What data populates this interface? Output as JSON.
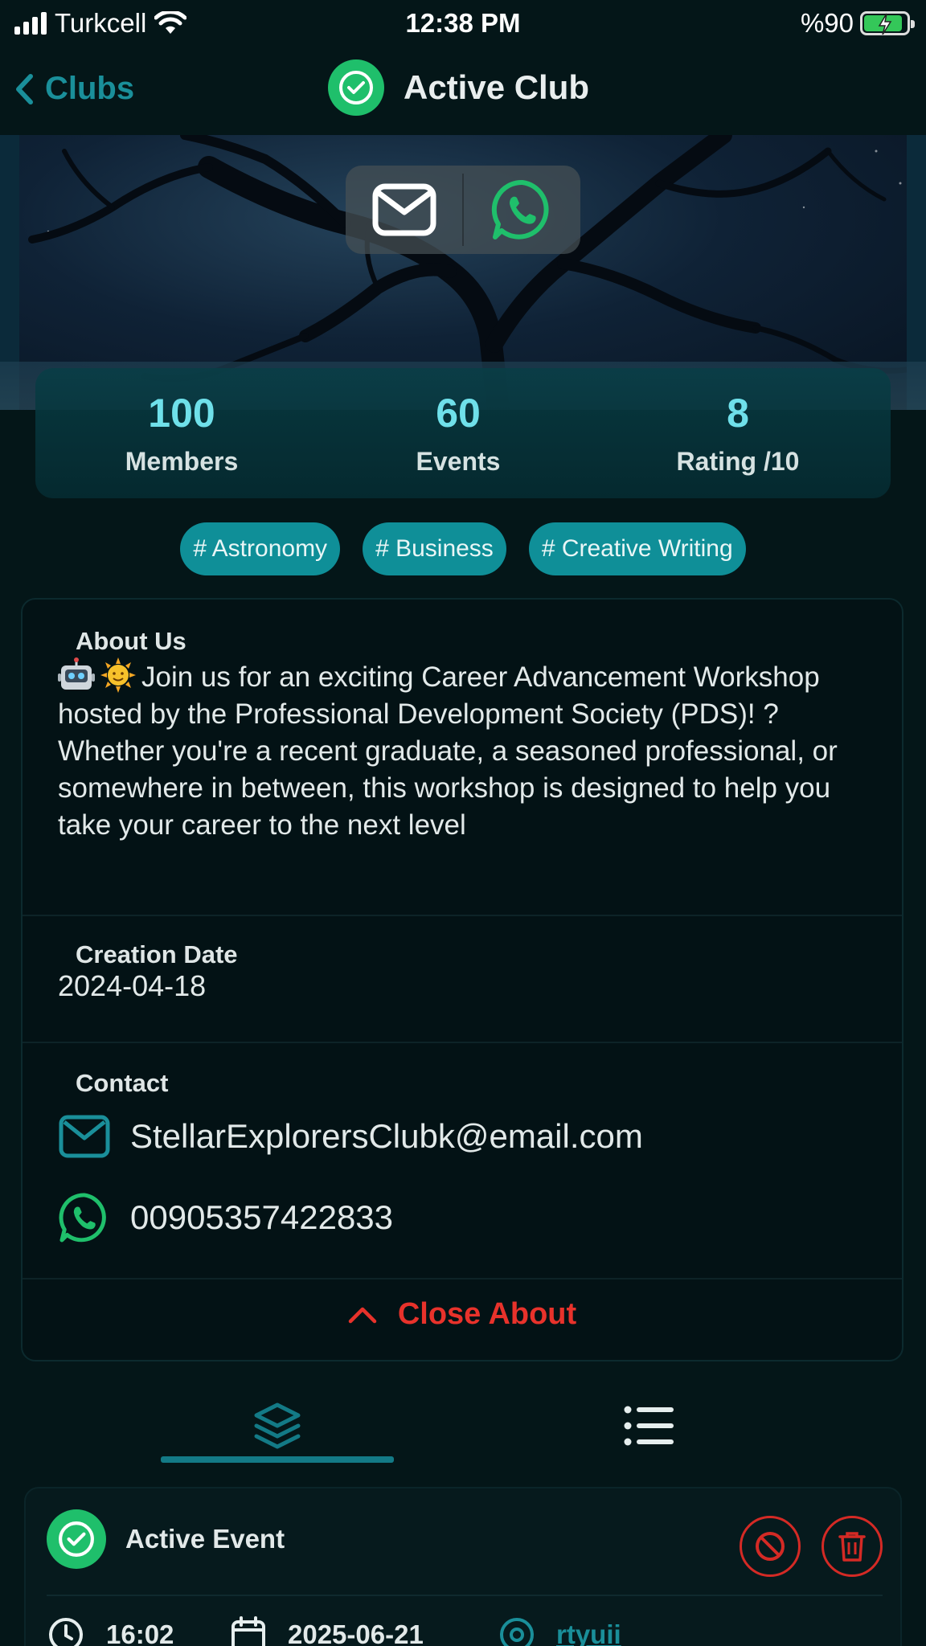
{
  "status_bar": {
    "carrier": "Turkcell",
    "time": "12:38 PM",
    "battery_text": "%90",
    "battery_level": 0.9
  },
  "nav": {
    "back_label": "Clubs",
    "title": "Active Club",
    "status_icon": "check-circle-icon"
  },
  "banner": {
    "contact_buttons": [
      "mail-icon",
      "whatsapp-icon"
    ]
  },
  "stats": [
    {
      "value": "100",
      "label": "Members"
    },
    {
      "value": "60",
      "label": "Events"
    },
    {
      "value": "8",
      "label": "Rating /10"
    }
  ],
  "tags": [
    "# Astronomy",
    "# Business",
    "# Creative Writing"
  ],
  "about": {
    "heading": "About Us",
    "emojis": [
      "robot-emoji",
      "sun-emoji"
    ],
    "text": "Join us for an exciting Career Advancement Workshop hosted by the Professional Development Society (PDS)! ? Whether you're a recent graduate, a seasoned professional, or somewhere in between, this workshop is designed to help you take your career to the next level",
    "creation_label": "Creation Date",
    "creation_date": "2024-04-18",
    "contact_label": "Contact",
    "email": "StellarExplorersClubk@email.com",
    "phone": "00905357422833",
    "close_label": "Close About"
  },
  "tabs": [
    {
      "icon": "layers-icon",
      "active": true
    },
    {
      "icon": "list-icon",
      "active": false
    }
  ],
  "event": {
    "status_label": "Active Event",
    "time": "16:02",
    "date": "2025-06-21",
    "location": "rtyuii"
  },
  "colors": {
    "background": "#041618",
    "accent": "#1a8f9a",
    "success": "#1fbf6b",
    "danger": "#e8322b",
    "stat_value": "#6fe0ea"
  }
}
